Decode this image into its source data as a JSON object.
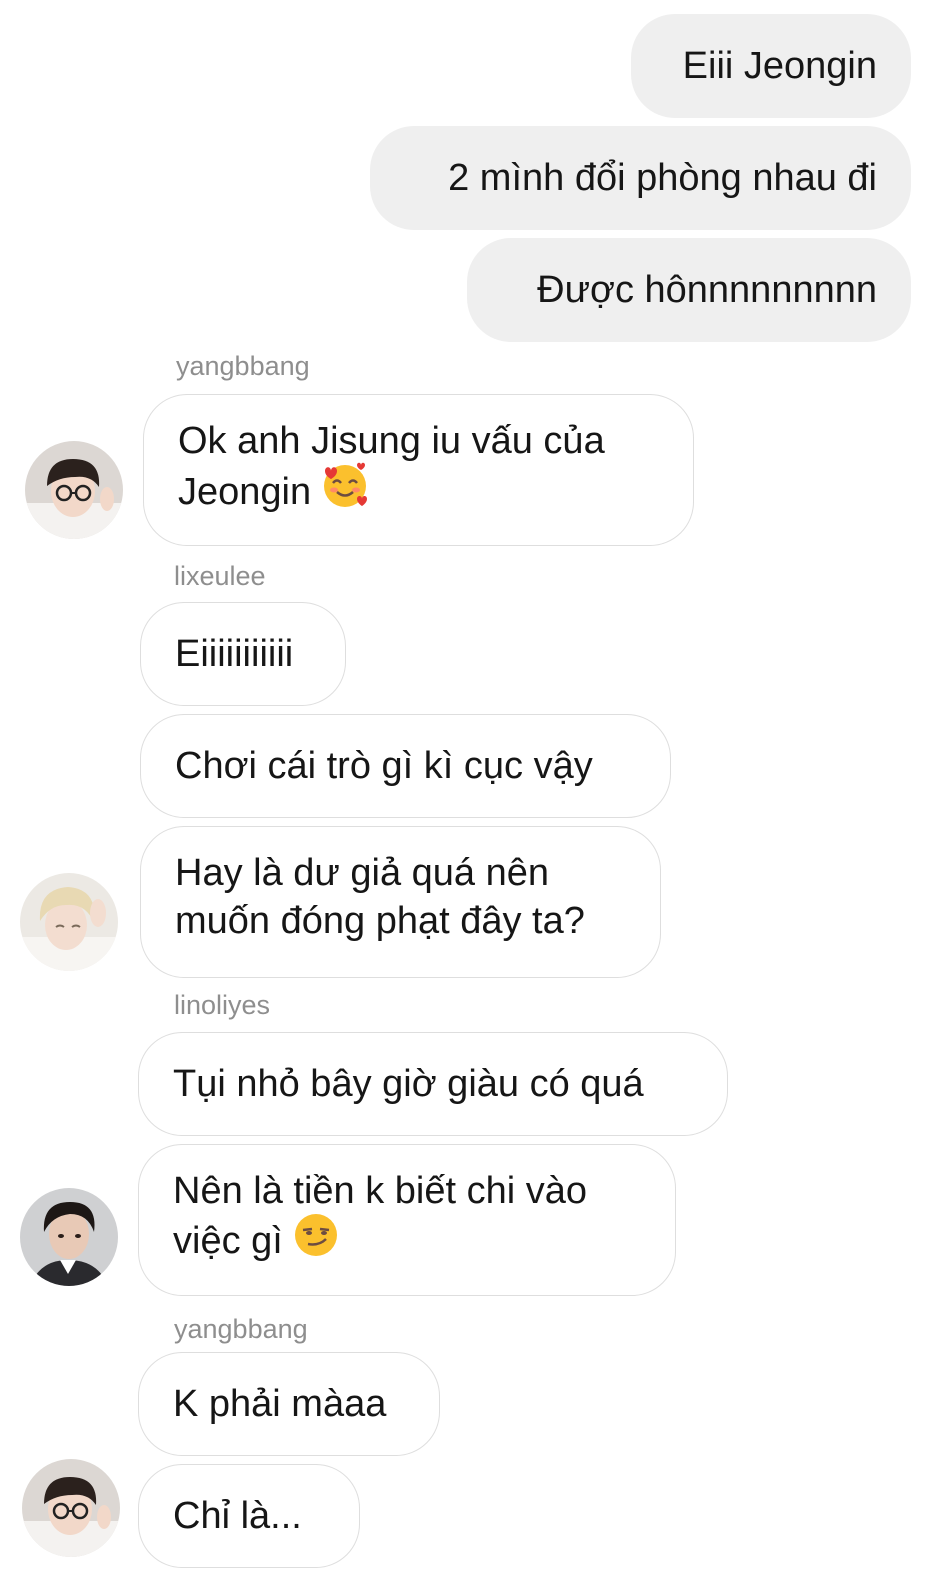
{
  "messages": [
    {
      "id": "m1",
      "direction": "outgoing",
      "text": "Eiii Jeongin"
    },
    {
      "id": "m2",
      "direction": "outgoing",
      "text": "2 mình đổi phòng nhau đi"
    },
    {
      "id": "m3",
      "direction": "outgoing",
      "text": "Được hônnnnnnnnn"
    },
    {
      "id": "m4",
      "direction": "incoming",
      "sender": "yangbbang",
      "lines": [
        "Ok anh Jisung iu vấu của",
        "Jeongin"
      ],
      "emoji": "smiling-face-with-hearts-emoji"
    },
    {
      "id": "m5",
      "direction": "incoming",
      "sender": "lixeulee",
      "text": "Eiiiiiiiiiii"
    },
    {
      "id": "m6",
      "direction": "incoming",
      "text": "Chơi cái trò gì kì cục vậy"
    },
    {
      "id": "m7",
      "direction": "incoming",
      "lines": [
        "Hay là dư giả quá nên",
        "muốn đóng phạt đây ta?"
      ]
    },
    {
      "id": "m8",
      "direction": "incoming",
      "sender": "linoliyes",
      "text": "Tụi nhỏ bây giờ giàu có quá"
    },
    {
      "id": "m9",
      "direction": "incoming",
      "lines": [
        "Nên là tiền k biết chi vào",
        "việc gì"
      ],
      "emoji": "smirking-face-emoji"
    },
    {
      "id": "m10",
      "direction": "incoming",
      "sender": "yangbbang",
      "text": "K phải màaa"
    },
    {
      "id": "m11",
      "direction": "incoming",
      "text": "Chỉ là..."
    }
  ],
  "avatars": [
    {
      "user": "yangbbang",
      "icon": "avatar-photo-dark-hair-glasses"
    },
    {
      "user": "lixeulee",
      "icon": "avatar-photo-blonde-hair"
    },
    {
      "user": "linoliyes",
      "icon": "avatar-photo-dark-hair"
    }
  ],
  "colors": {
    "outgoing_bubble": "#efefef",
    "incoming_border": "#dedede",
    "sender_label": "#8e8e8e"
  }
}
